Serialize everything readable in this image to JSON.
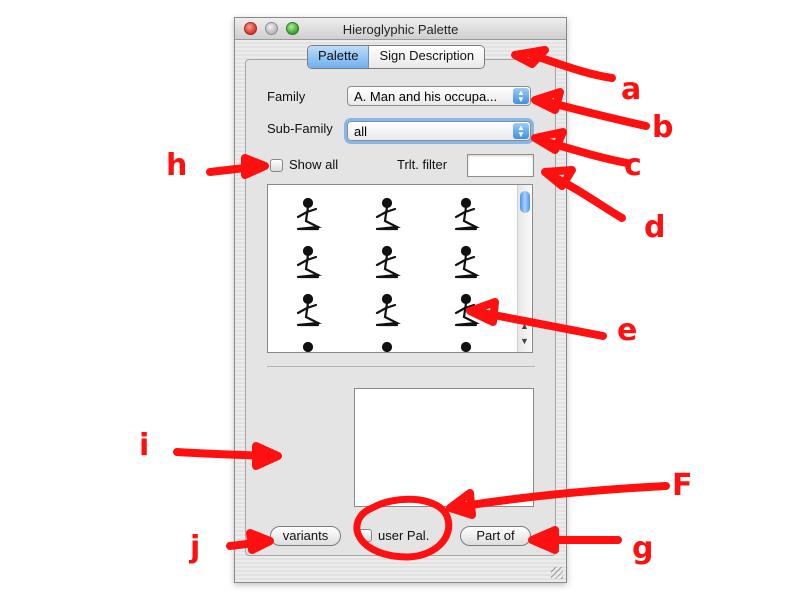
{
  "window": {
    "title": "Hieroglyphic Palette"
  },
  "tabs": [
    {
      "label": "Palette",
      "active": true
    },
    {
      "label": "Sign Description",
      "active": false
    }
  ],
  "family": {
    "label": "Family",
    "value": "A. Man and his occupa..."
  },
  "subfamily": {
    "label": "Sub-Family",
    "value": "all"
  },
  "show_all": {
    "label": "Show all",
    "checked": false
  },
  "trlt_filter": {
    "label": "Trlt. filter",
    "value": ""
  },
  "signs": [
    "seated-man-sign",
    "seated-man-sign",
    "seated-man-sign",
    "kneeling-man-sign",
    "man-with-frame-sign",
    "man-with-rope-sign",
    "kneeling-man-sign",
    "kneeling-man-sign",
    "man-with-basket-sign",
    "partial-sign",
    "partial-sign",
    "partial-sign"
  ],
  "buttons": {
    "variants": "variants",
    "user_pal": "user Pal.",
    "part_of": "Part of"
  },
  "user_pal_checked": false,
  "annotations": {
    "a": "a",
    "b": "b",
    "c": "c",
    "d": "d",
    "e": "e",
    "f": "F",
    "g": "g",
    "h": "h",
    "i": "i",
    "j": "j"
  },
  "colors": {
    "annotation": "#ff1010",
    "accent": "#6fb0ef"
  }
}
